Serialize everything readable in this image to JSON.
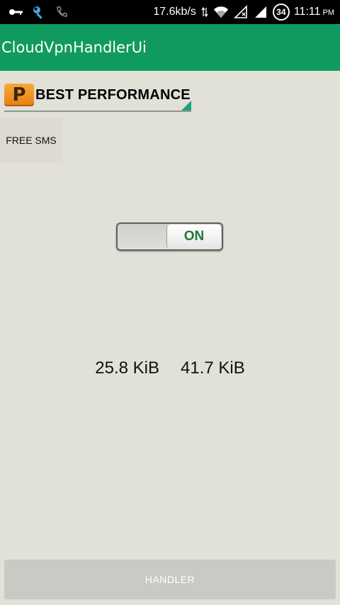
{
  "status_bar": {
    "icons_left": [
      "key-icon",
      "wrench-icon",
      "phone-icon"
    ],
    "network_speed": "17.6kb/s",
    "battery_level": "34",
    "time": "11:11",
    "ampm": "PM"
  },
  "app_bar": {
    "title": "CloudVpnHandlerUi",
    "color": "#119a5f"
  },
  "spinner": {
    "icon_letter": "P",
    "selected": "BEST PERFORMANCE"
  },
  "free_sms": {
    "label": "FREE SMS"
  },
  "toggle": {
    "state_label": "ON",
    "checked": true
  },
  "stats": {
    "received": "25.8 KiB",
    "sent": "41.7 KiB"
  },
  "handler_button": {
    "label": "HANDLER"
  }
}
